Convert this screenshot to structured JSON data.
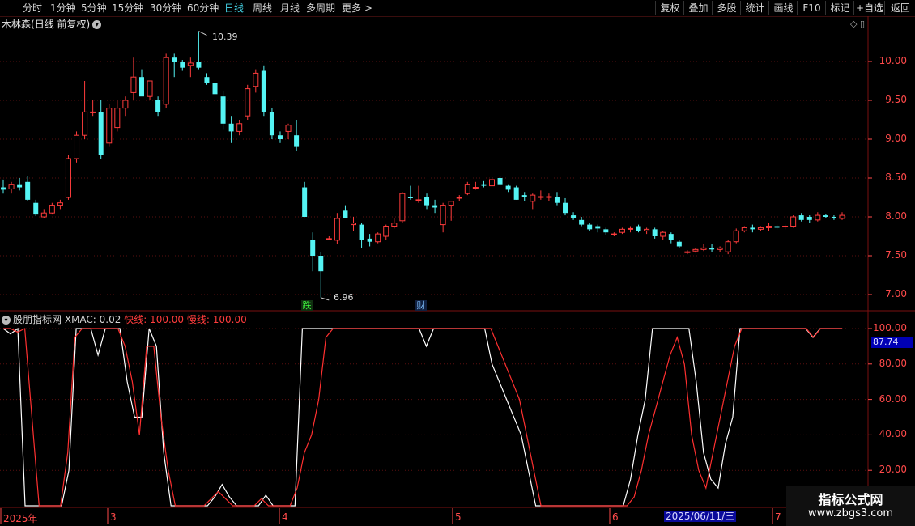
{
  "toolbar": {
    "periods": [
      "分时",
      "1分钟",
      "5分钟",
      "15分钟",
      "30分钟",
      "60分钟",
      "日线",
      "周线",
      "月线",
      "多周期",
      "更多 >"
    ],
    "active_period": "日线",
    "tools": [
      "复权",
      "叠加",
      "多股",
      "统计",
      "画线",
      "F10",
      "标记",
      "+自选",
      "返回"
    ]
  },
  "stock": {
    "name": "木林森",
    "mode": "(日线 前复权)"
  },
  "price_axis": {
    "ticks": [
      "10.00",
      "9.50",
      "9.00",
      "8.50",
      "8.00",
      "7.50",
      "7.00"
    ],
    "range": [
      6.9,
      10.5
    ],
    "high_label": "10.39",
    "low_label": "6.96"
  },
  "events": [
    {
      "label": "跌",
      "kind": "die"
    },
    {
      "label": "财",
      "kind": "cai"
    }
  ],
  "indicator": {
    "name": "股朋指标网",
    "xmac": "XMAC: 0.02",
    "fast": "快线: 100.00",
    "slow": "慢线: 100.00",
    "ticks": [
      "100.00",
      "80.00",
      "60.00",
      "40.00",
      "20.00"
    ],
    "range": [
      0,
      100
    ],
    "current_value": "87.74"
  },
  "date_axis": {
    "labels": [
      "2025年",
      "3",
      "4",
      "5",
      "6",
      "7"
    ],
    "cursor_date": "2025/06/11/三"
  },
  "watermark": {
    "line1": "指标公式网",
    "line2": "www.zbgs3.com"
  },
  "colors": {
    "up": "#ff3c3c",
    "down": "#54f4f4",
    "fast_line": "#ffffff",
    "slow_line": "#ff3030",
    "axis": "#ff4a4a",
    "grid": "#5a0f0f",
    "active": "#45d3e6"
  },
  "chart_data": [
    {
      "type": "candlestick",
      "title": "木林森(日线 前复权)",
      "ylim": [
        6.9,
        10.5
      ],
      "candles": [
        [
          8.38,
          8.48,
          8.3,
          8.35
        ],
        [
          8.36,
          8.45,
          8.3,
          8.42
        ],
        [
          8.42,
          8.5,
          8.34,
          8.38
        ],
        [
          8.45,
          8.52,
          8.2,
          8.22
        ],
        [
          8.18,
          8.22,
          8.01,
          8.03
        ],
        [
          8.0,
          8.1,
          7.98,
          8.05
        ],
        [
          8.05,
          8.18,
          8.03,
          8.15
        ],
        [
          8.15,
          8.22,
          8.1,
          8.18
        ],
        [
          8.25,
          8.8,
          8.22,
          8.75
        ],
        [
          8.75,
          9.1,
          8.7,
          9.05
        ],
        [
          9.05,
          9.75,
          9.0,
          9.35
        ],
        [
          9.35,
          9.5,
          9.3,
          9.35
        ],
        [
          9.35,
          9.5,
          8.75,
          8.8
        ],
        [
          8.95,
          9.45,
          8.9,
          9.4
        ],
        [
          9.15,
          9.5,
          9.1,
          9.4
        ],
        [
          9.4,
          9.55,
          9.3,
          9.5
        ],
        [
          9.6,
          10.05,
          9.5,
          9.8
        ],
        [
          9.8,
          9.9,
          9.6,
          9.55
        ],
        [
          9.55,
          9.75,
          9.5,
          9.75
        ],
        [
          9.5,
          9.55,
          9.3,
          9.35
        ],
        [
          9.45,
          10.1,
          9.4,
          10.05
        ],
        [
          10.05,
          10.1,
          9.8,
          10.0
        ],
        [
          10.0,
          10.02,
          9.88,
          9.92
        ],
        [
          9.95,
          10.05,
          9.8,
          9.98
        ],
        [
          10.0,
          10.39,
          9.9,
          9.92
        ],
        [
          9.8,
          9.85,
          9.7,
          9.72
        ],
        [
          9.72,
          9.8,
          9.55,
          9.58
        ],
        [
          9.55,
          9.62,
          9.12,
          9.2
        ],
        [
          9.2,
          9.3,
          8.95,
          9.1
        ],
        [
          9.1,
          9.25,
          9.05,
          9.2
        ],
        [
          9.3,
          9.7,
          9.25,
          9.65
        ],
        [
          9.68,
          9.9,
          9.6,
          9.85
        ],
        [
          9.88,
          9.95,
          9.3,
          9.35
        ],
        [
          9.35,
          9.4,
          9.0,
          9.05
        ],
        [
          9.05,
          9.1,
          8.95,
          9.0
        ],
        [
          9.1,
          9.2,
          9.0,
          9.18
        ],
        [
          9.05,
          9.25,
          8.85,
          8.9
        ],
        [
          8.38,
          8.45,
          8.1,
          8.0
        ],
        [
          7.7,
          7.8,
          7.3,
          7.5
        ],
        [
          7.5,
          7.55,
          6.96,
          7.3
        ],
        [
          7.72,
          7.75,
          7.72,
          7.72
        ],
        [
          7.7,
          8.05,
          7.65,
          7.98
        ],
        [
          8.08,
          8.15,
          7.98,
          7.98
        ],
        [
          7.9,
          8.0,
          7.82,
          7.92
        ],
        [
          7.9,
          7.92,
          7.6,
          7.7
        ],
        [
          7.72,
          7.78,
          7.62,
          7.68
        ],
        [
          7.68,
          7.8,
          7.66,
          7.78
        ],
        [
          7.75,
          7.9,
          7.7,
          7.88
        ],
        [
          7.88,
          7.98,
          7.85,
          7.92
        ],
        [
          7.95,
          8.32,
          7.92,
          8.3
        ],
        [
          8.25,
          8.4,
          8.22,
          8.24
        ],
        [
          8.22,
          8.4,
          8.18,
          8.22
        ],
        [
          8.25,
          8.3,
          8.1,
          8.15
        ],
        [
          8.15,
          8.22,
          8.05,
          8.12
        ],
        [
          7.9,
          8.18,
          7.8,
          8.15
        ],
        [
          8.15,
          8.2,
          7.95,
          8.2
        ],
        [
          8.25,
          8.28,
          8.2,
          8.25
        ],
        [
          8.3,
          8.45,
          8.28,
          8.42
        ],
        [
          8.38,
          8.45,
          8.35,
          8.38
        ],
        [
          8.42,
          8.46,
          8.38,
          8.4
        ],
        [
          8.4,
          8.5,
          8.38,
          8.48
        ],
        [
          8.5,
          8.52,
          8.4,
          8.42
        ],
        [
          8.4,
          8.42,
          8.32,
          8.35
        ],
        [
          8.38,
          8.4,
          8.22,
          8.22
        ],
        [
          8.28,
          8.32,
          8.2,
          8.26
        ],
        [
          8.2,
          8.3,
          8.1,
          8.28
        ],
        [
          8.26,
          8.34,
          8.22,
          8.26
        ],
        [
          8.26,
          8.3,
          8.2,
          8.26
        ],
        [
          8.26,
          8.32,
          8.15,
          8.18
        ],
        [
          8.18,
          8.24,
          8.02,
          8.05
        ],
        [
          8.02,
          8.06,
          7.96,
          7.98
        ],
        [
          7.96,
          8.0,
          7.88,
          7.9
        ],
        [
          7.9,
          7.92,
          7.82,
          7.84
        ],
        [
          7.88,
          7.9,
          7.8,
          7.85
        ],
        [
          7.84,
          7.86,
          7.76,
          7.8
        ],
        [
          7.78,
          7.8,
          7.75,
          7.78
        ],
        [
          7.8,
          7.86,
          7.78,
          7.84
        ],
        [
          7.84,
          7.88,
          7.8,
          7.85
        ],
        [
          7.88,
          7.9,
          7.8,
          7.82
        ],
        [
          7.82,
          7.86,
          7.78,
          7.84
        ],
        [
          7.84,
          7.86,
          7.72,
          7.75
        ],
        [
          7.75,
          7.82,
          7.7,
          7.8
        ],
        [
          7.78,
          7.8,
          7.66,
          7.7
        ],
        [
          7.68,
          7.7,
          7.6,
          7.62
        ],
        [
          7.55,
          7.57,
          7.52,
          7.55
        ],
        [
          7.56,
          7.6,
          7.54,
          7.58
        ],
        [
          7.58,
          7.65,
          7.56,
          7.6
        ],
        [
          7.6,
          7.65,
          7.55,
          7.58
        ],
        [
          7.58,
          7.62,
          7.55,
          7.6
        ],
        [
          7.55,
          7.7,
          7.52,
          7.68
        ],
        [
          7.68,
          7.85,
          7.66,
          7.82
        ],
        [
          7.82,
          7.88,
          7.8,
          7.86
        ],
        [
          7.86,
          7.9,
          7.8,
          7.84
        ],
        [
          7.84,
          7.88,
          7.82,
          7.86
        ],
        [
          7.86,
          7.92,
          7.82,
          7.88
        ],
        [
          7.88,
          7.9,
          7.84,
          7.86
        ],
        [
          7.88,
          7.9,
          7.84,
          7.88
        ],
        [
          7.88,
          8.02,
          7.86,
          8.0
        ],
        [
          8.02,
          8.05,
          7.94,
          7.96
        ],
        [
          8.0,
          8.02,
          7.92,
          7.96
        ],
        [
          7.96,
          8.06,
          7.94,
          8.02
        ],
        [
          8.02,
          8.04,
          7.98,
          8.0
        ],
        [
          8.0,
          8.02,
          7.96,
          7.98
        ],
        [
          7.98,
          8.06,
          7.96,
          8.02
        ]
      ]
    },
    {
      "type": "line",
      "title": "股朋指标网",
      "ylim": [
        0,
        100
      ],
      "series": [
        {
          "name": "快线",
          "values": [
            100,
            97,
            100,
            0,
            0,
            0,
            0,
            0,
            0,
            20,
            100,
            100,
            100,
            85,
            100,
            100,
            100,
            70,
            50,
            50,
            100,
            90,
            30,
            0,
            0,
            0,
            0,
            0,
            0,
            5,
            12,
            5,
            0,
            0,
            0,
            0,
            6,
            0,
            0,
            0,
            0,
            100,
            100,
            100,
            100,
            100,
            100,
            100,
            100,
            100,
            100,
            100,
            100,
            100,
            100,
            100,
            100,
            100,
            90,
            100,
            100,
            100,
            100,
            100,
            100,
            100,
            100,
            80,
            70,
            60,
            50,
            40,
            20,
            0,
            0,
            0,
            0,
            0,
            0,
            0,
            0,
            0,
            0,
            0,
            0,
            0,
            15,
            40,
            60,
            100,
            100,
            100,
            100,
            100,
            100,
            70,
            30,
            15,
            10,
            35,
            50,
            100,
            100,
            100,
            100,
            100,
            100,
            100,
            100,
            100,
            100,
            95,
            100,
            100,
            100,
            100
          ]
        },
        {
          "name": "慢线",
          "values": [
            100,
            100,
            98,
            100,
            50,
            0,
            0,
            0,
            0,
            30,
            95,
            100,
            100,
            100,
            100,
            100,
            100,
            90,
            70,
            40,
            90,
            90,
            50,
            20,
            0,
            0,
            0,
            0,
            0,
            4,
            8,
            4,
            0,
            0,
            0,
            0,
            4,
            0,
            0,
            0,
            0,
            10,
            30,
            40,
            60,
            95,
            100,
            100,
            100,
            100,
            100,
            100,
            100,
            100,
            100,
            100,
            100,
            100,
            100,
            100,
            100,
            100,
            100,
            100,
            100,
            100,
            100,
            100,
            100,
            90,
            80,
            70,
            60,
            40,
            20,
            0,
            0,
            0,
            0,
            0,
            0,
            0,
            0,
            0,
            0,
            0,
            0,
            0,
            5,
            20,
            40,
            55,
            70,
            85,
            95,
            80,
            40,
            20,
            10,
            30,
            50,
            70,
            90,
            100,
            100,
            100,
            100,
            100,
            100,
            100,
            100,
            100,
            100,
            95,
            100,
            100,
            100,
            100
          ]
        }
      ]
    }
  ]
}
